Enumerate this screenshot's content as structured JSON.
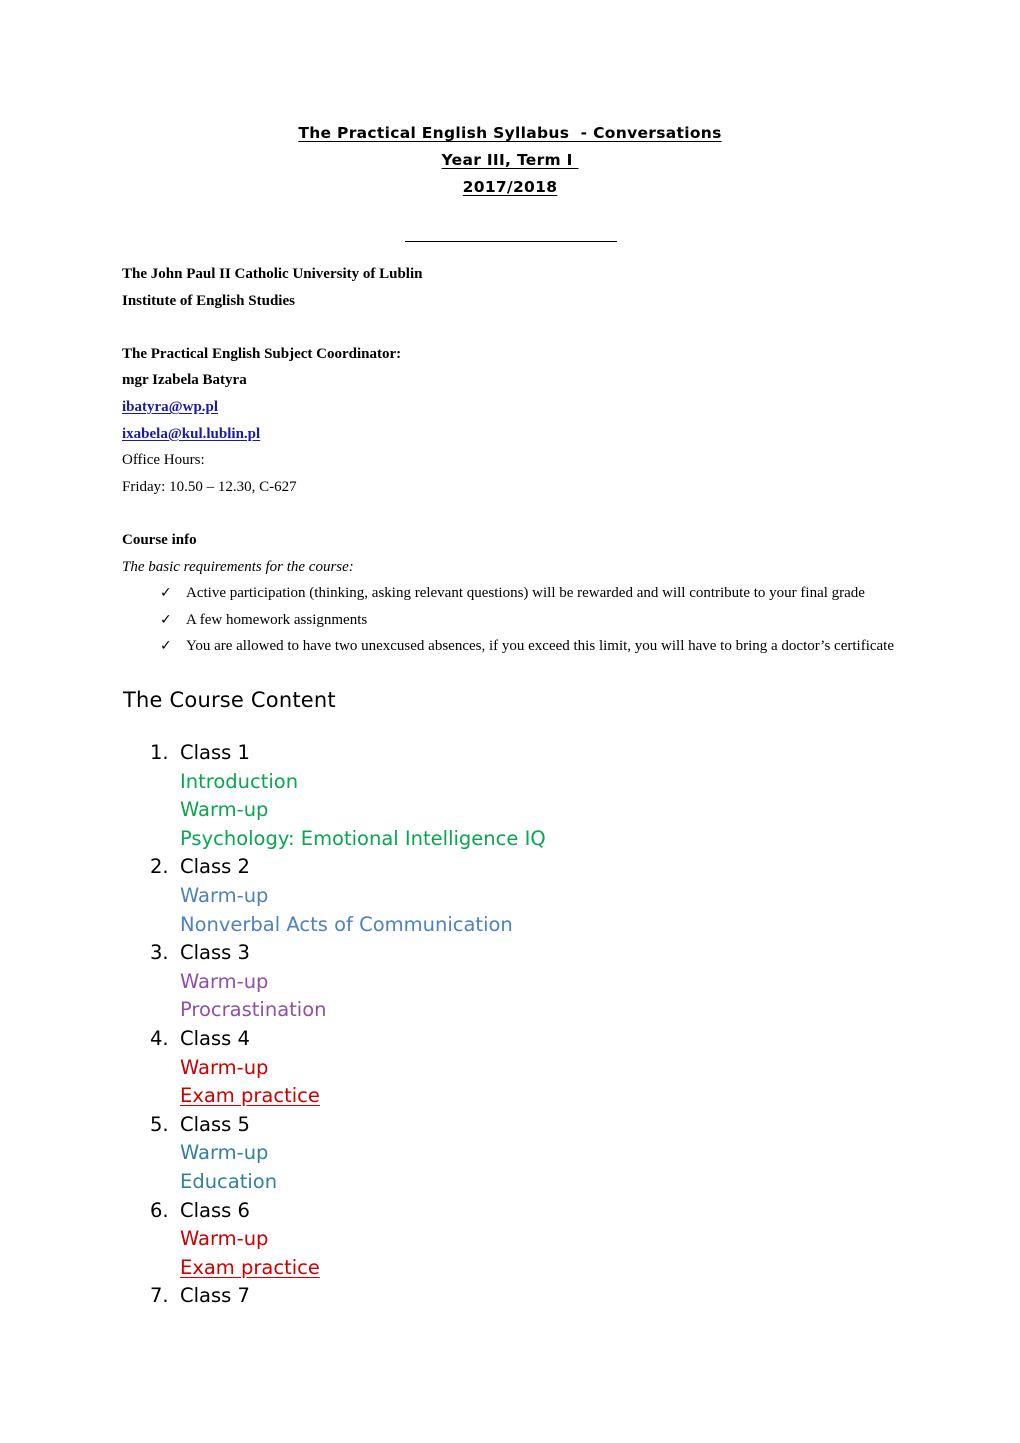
{
  "document": {
    "title_lines": [
      "The Practical English Syllabus  - Conversations",
      "Year III, Term I ",
      "2017/2018"
    ],
    "institution": {
      "university": "The John Paul  II Catholic University of Lublin",
      "institute": "Institute of English Studies"
    },
    "coordinator": {
      "role_label": "The Practical English Subject Coordinator:",
      "name": "mgr Izabela Batyra",
      "emails": [
        " ibatyra@wp.pl",
        "ixabela@kul.lublin.pl"
      ],
      "office_hours_label": "Office Hours:",
      "office_hours_value": "Friday: 10.50 – 12.30, C-627"
    },
    "course_info": {
      "heading": "Course info",
      "requirements_intro": "The  basic requirements for the course:",
      "tick_glyph": "✓",
      "requirements": [
        "Active participation (thinking, asking relevant questions) will be rewarded and will contribute to your final grade",
        "A few homework assignments",
        "You are allowed to have two unexcused absences, if you exceed this limit, you will have to bring a doctor’s certificate"
      ]
    },
    "course_content": {
      "heading": "The Course Content",
      "classes": [
        {
          "number": "1.",
          "label": "Class 1",
          "color": "#0aa550",
          "topics": [
            {
              "text": "Introduction",
              "underline": false
            },
            {
              "text": "Warm-up",
              "underline": false
            },
            {
              "text": "Psychology: Emotional Intelligence IQ",
              "underline": false
            }
          ]
        },
        {
          "number": "2.",
          "label": "Class 2",
          "color": "#4f81bd",
          "topics": [
            {
              "text": "Warm-up",
              "underline": false
            },
            {
              "text": "Nonverbal Acts of Communication",
              "underline": false
            }
          ]
        },
        {
          "number": "3.",
          "label": "Class 3",
          "color": "#8f4fa8",
          "topics": [
            {
              "text": "Warm-up",
              "underline": false
            },
            {
              "text": "Procrastination",
              "underline": false
            }
          ]
        },
        {
          "number": "4.",
          "label": "Class 4",
          "color": "#cc0000",
          "topics": [
            {
              "text": "Warm-up",
              "underline": false
            },
            {
              "text": "Exam practice",
              "underline": true
            }
          ]
        },
        {
          "number": "5.",
          "label": "Class 5",
          "color": "#31819b",
          "topics": [
            {
              "text": "Warm-up",
              "underline": false
            },
            {
              "text": "Education",
              "underline": false
            }
          ]
        },
        {
          "number": "6.",
          "label": "Class 6",
          "color": "#cc0000",
          "topics": [
            {
              "text": "Warm-up",
              "underline": false
            },
            {
              "text": "Exam practice",
              "underline": true
            }
          ]
        },
        {
          "number": "7.",
          "label": "Class 7",
          "color": "#000000",
          "topics": []
        }
      ]
    },
    "colors": {
      "link": "#1a1aa8",
      "green": "#0aa550",
      "blue": "#4f81bd",
      "purple": "#8f4fa8",
      "red": "#cc0000",
      "teal": "#31819b",
      "text": "#000000",
      "background": "#ffffff"
    }
  }
}
